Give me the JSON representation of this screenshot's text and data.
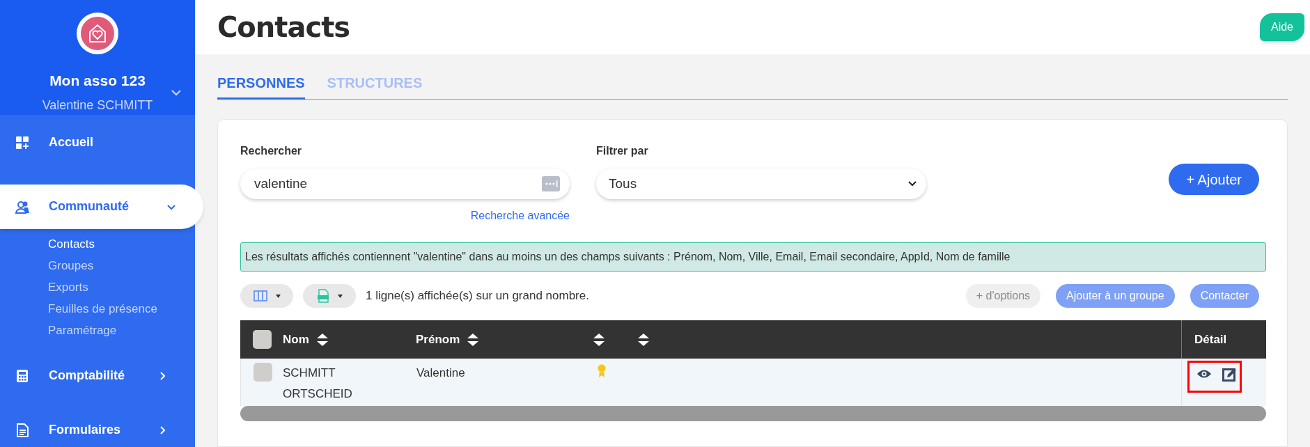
{
  "sidebar": {
    "org_name": "Mon asso 123",
    "user_name": "Valentine SCHMITT",
    "items": [
      {
        "label": "Accueil",
        "kind": "link",
        "selected": false
      },
      {
        "label": "Communauté",
        "kind": "menu",
        "selected": true,
        "expanded": true,
        "children": [
          {
            "label": "Contacts",
            "selected": true
          },
          {
            "label": "Groupes",
            "selected": false
          },
          {
            "label": "Exports",
            "selected": false
          },
          {
            "label": "Feuilles de présence",
            "selected": false
          },
          {
            "label": "Paramétrage",
            "selected": false
          }
        ]
      },
      {
        "label": "Comptabilité",
        "kind": "menu",
        "selected": false,
        "expanded": false
      },
      {
        "label": "Formulaires",
        "kind": "menu",
        "selected": false,
        "expanded": false
      }
    ]
  },
  "page": {
    "title": "Contacts",
    "help_button": "Aide"
  },
  "tabs": [
    {
      "label": "PERSONNES",
      "selected": true
    },
    {
      "label": "STRUCTURES",
      "selected": false
    }
  ],
  "search": {
    "label": "Rechercher",
    "value": "valentine",
    "advanced_link": "Recherche avancée"
  },
  "filter": {
    "label": "Filtrer par",
    "value": "Tous"
  },
  "add_button": "+ Ajouter",
  "info_message": "Les résultats affichés contiennent \"valentine\" dans au moins un des champs suivants : Prénom, Nom, Ville, Email, Email secondaire, AppId, Nom de famille",
  "toolbar": {
    "count_text": "1 ligne(s) affichée(s) sur un grand nombre.",
    "buttons": [
      {
        "label": "+ d'options",
        "disabled": true
      },
      {
        "label": "Ajouter à un groupe",
        "disabled": false
      },
      {
        "label": "Contacter",
        "disabled": false
      }
    ]
  },
  "table": {
    "columns": [
      {
        "label": "Nom",
        "sortable": true
      },
      {
        "label": "Prénom",
        "sortable": true
      },
      {
        "sortable": true
      },
      {
        "sortable": true
      }
    ],
    "detail_column": "Détail",
    "select_all_checked": false,
    "rows": [
      {
        "nom": "SCHMITT ORTSCHEID",
        "prenom": "Valentine",
        "checked": false,
        "badge": true,
        "highlighted": true
      }
    ]
  }
}
